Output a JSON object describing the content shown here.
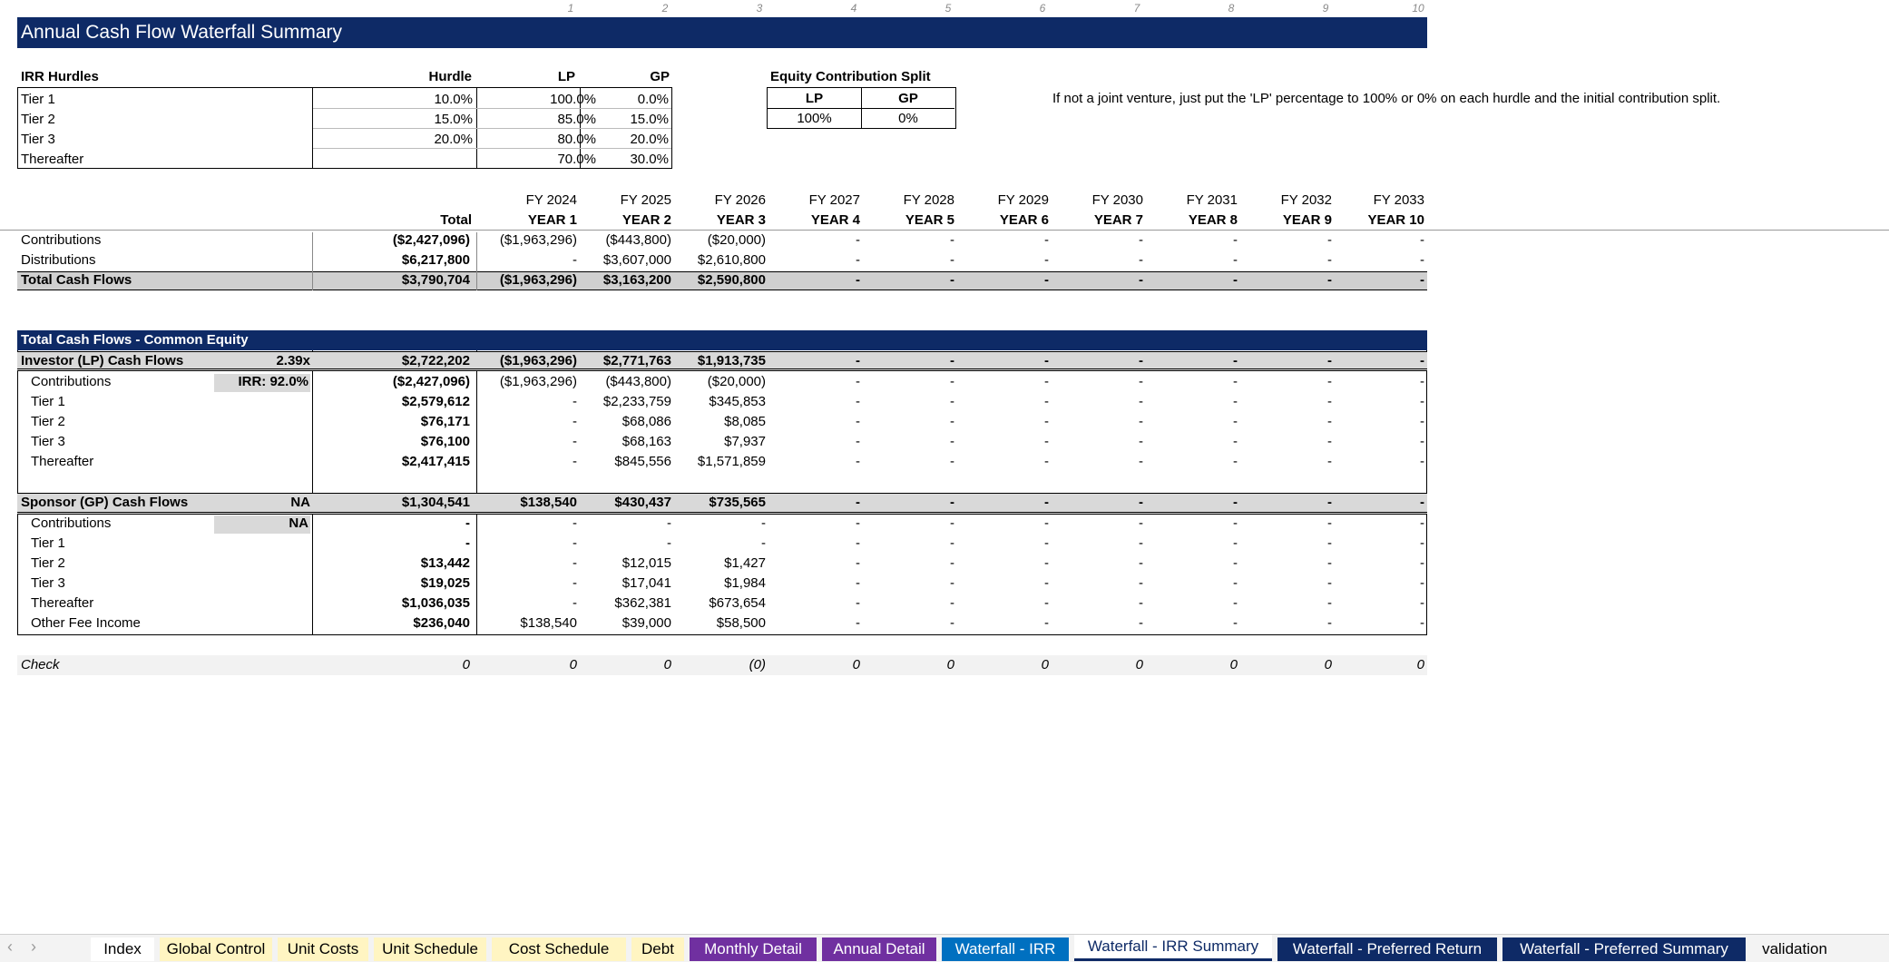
{
  "title": "Annual Cash Flow Waterfall Summary",
  "column_numbers": [
    "1",
    "2",
    "3",
    "4",
    "5",
    "6",
    "7",
    "8",
    "9",
    "10"
  ],
  "irr_hurdles": {
    "header": "IRR Hurdles",
    "cols": [
      "Hurdle",
      "LP",
      "GP"
    ],
    "rows": [
      {
        "label": "Tier 1",
        "hurdle": "10.0%",
        "lp": "100.0%",
        "gp": "0.0%"
      },
      {
        "label": "Tier 2",
        "hurdle": "15.0%",
        "lp": "85.0%",
        "gp": "15.0%"
      },
      {
        "label": "Tier 3",
        "hurdle": "20.0%",
        "lp": "80.0%",
        "gp": "20.0%"
      },
      {
        "label": "Thereafter",
        "hurdle": "",
        "lp": "70.0%",
        "gp": "30.0%"
      }
    ]
  },
  "equity_split": {
    "header": "Equity Contribution Split",
    "lp_label": "LP",
    "gp_label": "GP",
    "lp": "100%",
    "gp": "0%"
  },
  "note": "If not a joint venture, just put the 'LP' percentage to 100% or 0% on each hurdle and the initial contribution split.",
  "years_fy": [
    "FY 2024",
    "FY 2025",
    "FY 2026",
    "FY 2027",
    "FY 2028",
    "FY 2029",
    "FY 2030",
    "FY 2031",
    "FY 2032",
    "FY 2033"
  ],
  "years_label": [
    "YEAR 1",
    "YEAR 2",
    "YEAR 3",
    "YEAR 4",
    "YEAR 5",
    "YEAR 6",
    "YEAR 7",
    "YEAR 8",
    "YEAR 9",
    "YEAR 10"
  ],
  "total_label": "Total",
  "summary": [
    {
      "label": "Contributions",
      "total": "($2,427,096)",
      "vals": [
        "($1,963,296)",
        "($443,800)",
        "($20,000)",
        "-",
        "-",
        "-",
        "-",
        "-",
        "-",
        "-"
      ]
    },
    {
      "label": "Distributions",
      "total": "$6,217,800",
      "vals": [
        "-",
        "$3,607,000",
        "$2,610,800",
        "-",
        "-",
        "-",
        "-",
        "-",
        "-",
        "-"
      ]
    },
    {
      "label": "Total Cash Flows",
      "total": "$3,790,704",
      "vals": [
        "($1,963,296)",
        "$3,163,200",
        "$2,590,800",
        "-",
        "-",
        "-",
        "-",
        "-",
        "-",
        "-"
      ]
    }
  ],
  "common_equity_header": "Total Cash Flows - Common Equity",
  "lp": {
    "label": "Investor (LP) Cash Flows",
    "multiple": "2.39x",
    "irr": "IRR: 92.0%",
    "total": "$2,722,202",
    "vals": [
      "($1,963,296)",
      "$2,771,763",
      "$1,913,735",
      "-",
      "-",
      "-",
      "-",
      "-",
      "-",
      "-"
    ],
    "rows": [
      {
        "label": "Contributions",
        "total": "($2,427,096)",
        "vals": [
          "($1,963,296)",
          "($443,800)",
          "($20,000)",
          "-",
          "-",
          "-",
          "-",
          "-",
          "-",
          "-"
        ]
      },
      {
        "label": "Tier 1",
        "total": "$2,579,612",
        "vals": [
          "-",
          "$2,233,759",
          "$345,853",
          "-",
          "-",
          "-",
          "-",
          "-",
          "-",
          "-"
        ]
      },
      {
        "label": "Tier 2",
        "total": "$76,171",
        "vals": [
          "-",
          "$68,086",
          "$8,085",
          "-",
          "-",
          "-",
          "-",
          "-",
          "-",
          "-"
        ]
      },
      {
        "label": "Tier 3",
        "total": "$76,100",
        "vals": [
          "-",
          "$68,163",
          "$7,937",
          "-",
          "-",
          "-",
          "-",
          "-",
          "-",
          "-"
        ]
      },
      {
        "label": "Thereafter",
        "total": "$2,417,415",
        "vals": [
          "-",
          "$845,556",
          "$1,571,859",
          "-",
          "-",
          "-",
          "-",
          "-",
          "-",
          "-"
        ]
      }
    ]
  },
  "gp": {
    "label": "Sponsor (GP) Cash Flows",
    "multiple": "NA",
    "irr": "NA",
    "total": "$1,304,541",
    "vals": [
      "$138,540",
      "$430,437",
      "$735,565",
      "-",
      "-",
      "-",
      "-",
      "-",
      "-",
      "-"
    ],
    "rows": [
      {
        "label": "Contributions",
        "total": "-",
        "vals": [
          "-",
          "-",
          "-",
          "-",
          "-",
          "-",
          "-",
          "-",
          "-",
          "-"
        ]
      },
      {
        "label": "Tier 1",
        "total": "-",
        "vals": [
          "-",
          "-",
          "-",
          "-",
          "-",
          "-",
          "-",
          "-",
          "-",
          "-"
        ]
      },
      {
        "label": "Tier 2",
        "total": "$13,442",
        "vals": [
          "-",
          "$12,015",
          "$1,427",
          "-",
          "-",
          "-",
          "-",
          "-",
          "-",
          "-"
        ]
      },
      {
        "label": "Tier 3",
        "total": "$19,025",
        "vals": [
          "-",
          "$17,041",
          "$1,984",
          "-",
          "-",
          "-",
          "-",
          "-",
          "-",
          "-"
        ]
      },
      {
        "label": "Thereafter",
        "total": "$1,036,035",
        "vals": [
          "-",
          "$362,381",
          "$673,654",
          "-",
          "-",
          "-",
          "-",
          "-",
          "-",
          "-"
        ]
      },
      {
        "label": "Other Fee Income",
        "total": "$236,040",
        "vals": [
          "$138,540",
          "$39,000",
          "$58,500",
          "-",
          "-",
          "-",
          "-",
          "-",
          "-",
          "-"
        ]
      }
    ]
  },
  "check": {
    "label": "Check",
    "total": "0",
    "vals": [
      "0",
      "0",
      "(0)",
      "0",
      "0",
      "0",
      "0",
      "0",
      "0",
      "0"
    ]
  },
  "nav": {
    "prev": "‹",
    "next": "›"
  },
  "tabs": [
    {
      "label": "Index",
      "color": "#ffffff",
      "text": "#000000"
    },
    {
      "label": "Global Control",
      "color": "#fff5c2",
      "text": "#000000"
    },
    {
      "label": "Unit Costs",
      "color": "#fff5c2",
      "text": "#000000"
    },
    {
      "label": "Unit Schedule",
      "color": "#fff5c2",
      "text": "#000000"
    },
    {
      "label": "Cost Schedule",
      "color": "#fff5c2",
      "text": "#000000"
    },
    {
      "label": "Debt",
      "color": "#fff5c2",
      "text": "#000000"
    },
    {
      "label": "Monthly Detail",
      "color": "#7030a0",
      "text": "#ffffff"
    },
    {
      "label": "Annual Detail",
      "color": "#7030a0",
      "text": "#ffffff"
    },
    {
      "label": "Waterfall - IRR",
      "color": "#0070c0",
      "text": "#ffffff"
    },
    {
      "label": "Waterfall - IRR Summary",
      "color": "#ffffff",
      "text": "#0e2a66"
    },
    {
      "label": "Waterfall - Preferred Return",
      "color": "#0e2a66",
      "text": "#ffffff"
    },
    {
      "label": "Waterfall - Preferred Summary",
      "color": "#0e2a66",
      "text": "#ffffff"
    },
    {
      "label": "validation",
      "color": "#f3f3f3",
      "text": "#000000"
    }
  ]
}
